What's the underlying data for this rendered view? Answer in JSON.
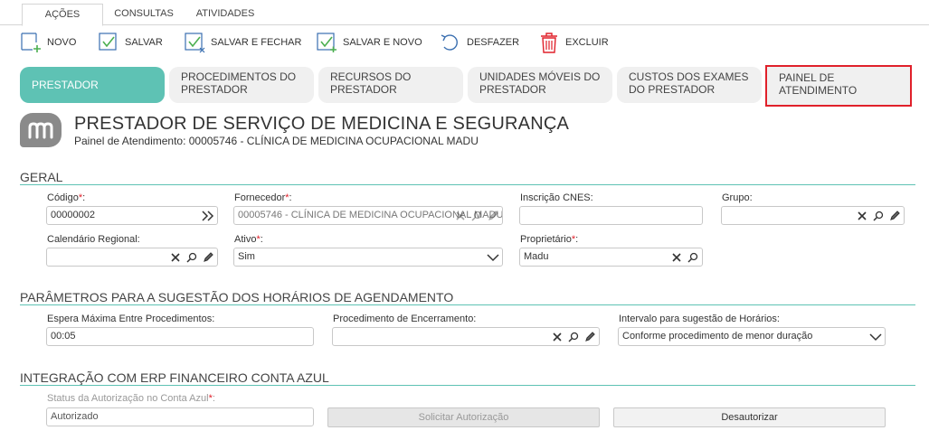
{
  "top_tabs": [
    "AÇÕES",
    "CONSULTAS",
    "ATIVIDADES"
  ],
  "toolbar": {
    "novo": "NOVO",
    "salvar": "SALVAR",
    "salvar_fechar": "SALVAR E FECHAR",
    "salvar_novo": "SALVAR E NOVO",
    "desfazer": "DESFAZER",
    "excluir": "EXCLUIR"
  },
  "section_tabs": [
    {
      "label": "PRESTADOR",
      "state": "active"
    },
    {
      "label": "PROCEDIMENTOS DO PRESTADOR",
      "state": "normal"
    },
    {
      "label": "RECURSOS DO PRESTADOR",
      "state": "normal"
    },
    {
      "label": "UNIDADES MÓVEIS DO PRESTADOR",
      "state": "normal"
    },
    {
      "label": "CUSTOS DOS EXAMES DO PRESTADOR",
      "state": "normal"
    },
    {
      "label": "PAINEL DE ATENDIMENTO",
      "state": "highlighted"
    }
  ],
  "header": {
    "title": "PRESTADOR DE SERVIÇO DE MEDICINA E SEGURANÇA",
    "subtitle": "Painel de Atendimento: 00005746 - CLÍNICA DE MEDICINA OCUPACIONAL MADU"
  },
  "geral": {
    "title": "GERAL",
    "codigo": {
      "label": "Código",
      "value": "00000002"
    },
    "fornecedor": {
      "label": "Fornecedor",
      "value": "00005746 - CLÍNICA DE MEDICINA OCUPACIONAL MADU"
    },
    "cnes": {
      "label": "Inscrição CNES:",
      "value": ""
    },
    "grupo": {
      "label": "Grupo:",
      "value": ""
    },
    "calendario": {
      "label": "Calendário Regional:",
      "value": ""
    },
    "ativo": {
      "label": "Ativo",
      "value": "Sim"
    },
    "proprietario": {
      "label": "Proprietário",
      "value": "Madu"
    }
  },
  "parametros": {
    "title": "PARÂMETROS PARA A SUGESTÃO DOS HORÁRIOS DE AGENDAMENTO",
    "espera": {
      "label": "Espera Máxima Entre Procedimentos:",
      "value": "00:05"
    },
    "encerramento": {
      "label": "Procedimento de Encerramento:",
      "value": ""
    },
    "intervalo": {
      "label": "Intervalo para sugestão de Horários:",
      "value": "Conforme procedimento de menor duração"
    }
  },
  "integracao": {
    "title": "INTEGRAÇÃO COM ERP FINANCEIRO CONTA AZUL",
    "status": {
      "label": "Status da Autorização no Conta Azul",
      "value": "Autorizado"
    },
    "solicitar": "Solicitar Autorização",
    "desautorizar": "Desautorizar"
  },
  "required_mark": "*",
  "label_suffix": ":",
  "colors": {
    "accent": "#5ec2b4",
    "highlight": "#e0202a",
    "required": "#e0202a"
  }
}
